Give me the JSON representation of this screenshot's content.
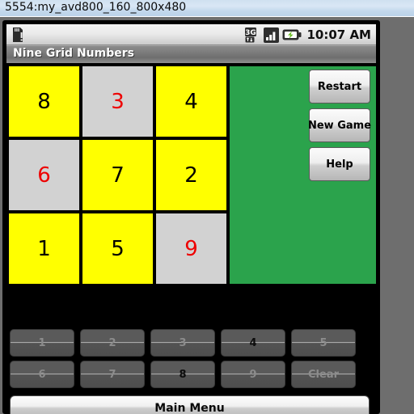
{
  "window": {
    "title": "5554:my_avd800_160_800x480"
  },
  "statusbar": {
    "sd_icon": "sd-card-icon",
    "data_icon": "3g-data-icon",
    "signal_icon": "signal-bars-icon",
    "battery_icon": "battery-charging-icon",
    "clock": "10:07 AM"
  },
  "app": {
    "title": "Nine Grid Numbers"
  },
  "grid": {
    "cells": [
      {
        "value": "8",
        "type": "fixed"
      },
      {
        "value": "3",
        "type": "entry"
      },
      {
        "value": "4",
        "type": "fixed"
      },
      {
        "value": "6",
        "type": "entry"
      },
      {
        "value": "7",
        "type": "fixed"
      },
      {
        "value": "2",
        "type": "fixed"
      },
      {
        "value": "1",
        "type": "fixed"
      },
      {
        "value": "5",
        "type": "fixed"
      },
      {
        "value": "9",
        "type": "entry"
      }
    ]
  },
  "actions": {
    "restart": "Restart",
    "new_game": "New Game",
    "help": "Help"
  },
  "keypad": {
    "row1": [
      {
        "label": "1",
        "enabled": false
      },
      {
        "label": "2",
        "enabled": false
      },
      {
        "label": "3",
        "enabled": false
      },
      {
        "label": "4",
        "enabled": true
      },
      {
        "label": "5",
        "enabled": false
      }
    ],
    "row2": [
      {
        "label": "6",
        "enabled": false
      },
      {
        "label": "7",
        "enabled": false
      },
      {
        "label": "8",
        "enabled": true
      },
      {
        "label": "9",
        "enabled": false
      },
      {
        "label": "Clear",
        "enabled": false
      }
    ]
  },
  "footer": {
    "main_menu": "Main Menu"
  },
  "colors": {
    "fixed_cell_bg": "#ffff00",
    "fixed_cell_fg": "#000000",
    "entry_cell_bg": "#d2d2d2",
    "entry_cell_fg": "#ee0000",
    "side_panel_bg": "#2ba34c",
    "screen_bg": "#000000",
    "chassis": "#6e6e6e"
  }
}
